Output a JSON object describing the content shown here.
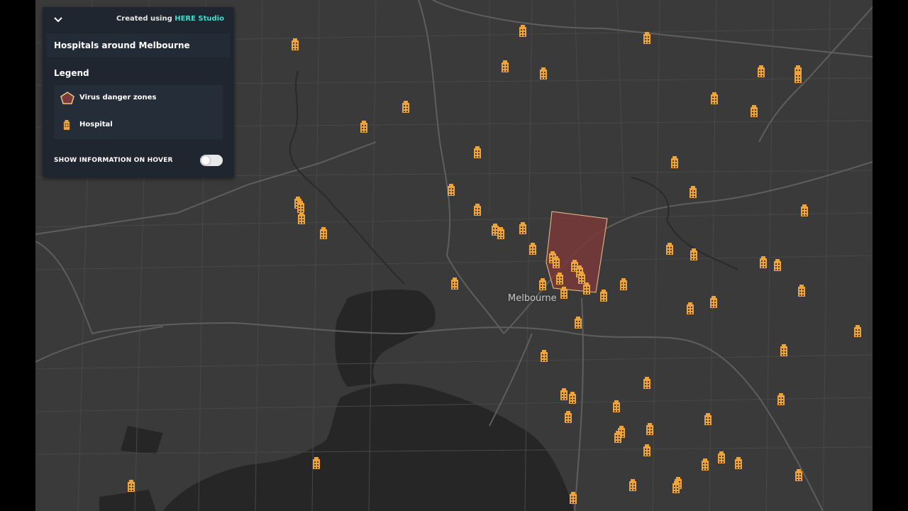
{
  "panel": {
    "credit_prefix": "Created using",
    "credit_brand": "HERE Studio",
    "title": "Hospitals around Melbourne",
    "legend_title": "Legend",
    "legend_items": [
      {
        "label": "Virus danger zones",
        "icon": "pentagon-icon"
      },
      {
        "label": "Hospital",
        "icon": "hospital-icon"
      }
    ],
    "hover_toggle_label": "SHOW INFORMATION ON HOVER",
    "hover_toggle_on": false
  },
  "map": {
    "city_label": "Melbourne",
    "colors": {
      "background": "#3a3a3a",
      "water": "#262626",
      "roads": "#5a5a5a",
      "highways": "#6e6e6e",
      "hospital": "#f0a338",
      "danger_zone_fill": "#7a3a3a",
      "danger_zone_stroke": "#f0c48a",
      "panel_bg": "#1f2630",
      "brand": "#48dad0"
    }
  }
}
